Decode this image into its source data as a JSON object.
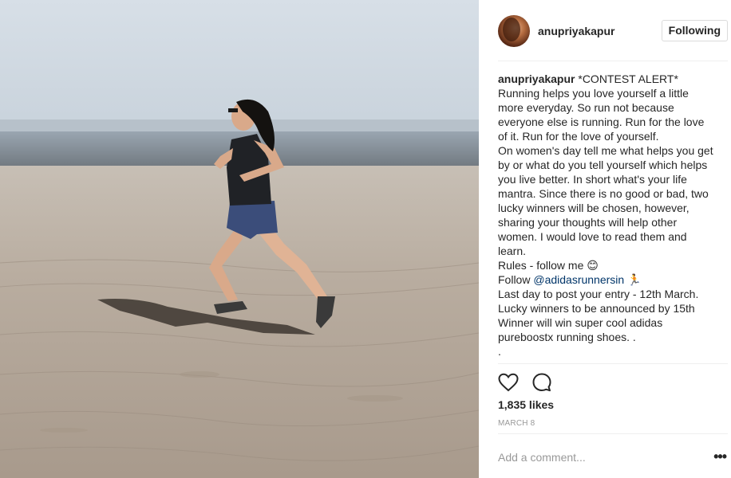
{
  "post": {
    "username": "anupriyakapur",
    "follow_button": "Following",
    "caption": {
      "username": "anupriyakapur",
      "lead": "*CONTEST ALERT*",
      "body_1": "Running helps you love yourself a little more everyday. So run not because everyone else is running. Run for the love of it. Run for the love of yourself.\nOn women's day tell me what helps you get by or what do you tell yourself which helps you live better. In short what's your life mantra. Since there is no good or bad, two lucky winners will be chosen, however, sharing your thoughts will help other women. I would love to read them and learn.\nRules - follow me 😊\nFollow ",
      "mention": "@adidasrunnersin",
      "body_2": " 🏃\nLast day to post your entry - 12th March.\nLucky winners to be announced by 15th\nWinner will win super cool adidas pureboostx running shoes. .\n."
    },
    "likes": "1,835 likes",
    "date": "MARCH 8",
    "comment_placeholder": "Add a comment...",
    "more_label": "•••"
  },
  "icons": {
    "like": "heart-icon",
    "comment": "comment-icon",
    "more": "ellipsis-icon"
  },
  "colors": {
    "text": "#262626",
    "muted": "#999999",
    "link": "#003569",
    "border": "#dbdbdb",
    "divider": "#efefef"
  }
}
